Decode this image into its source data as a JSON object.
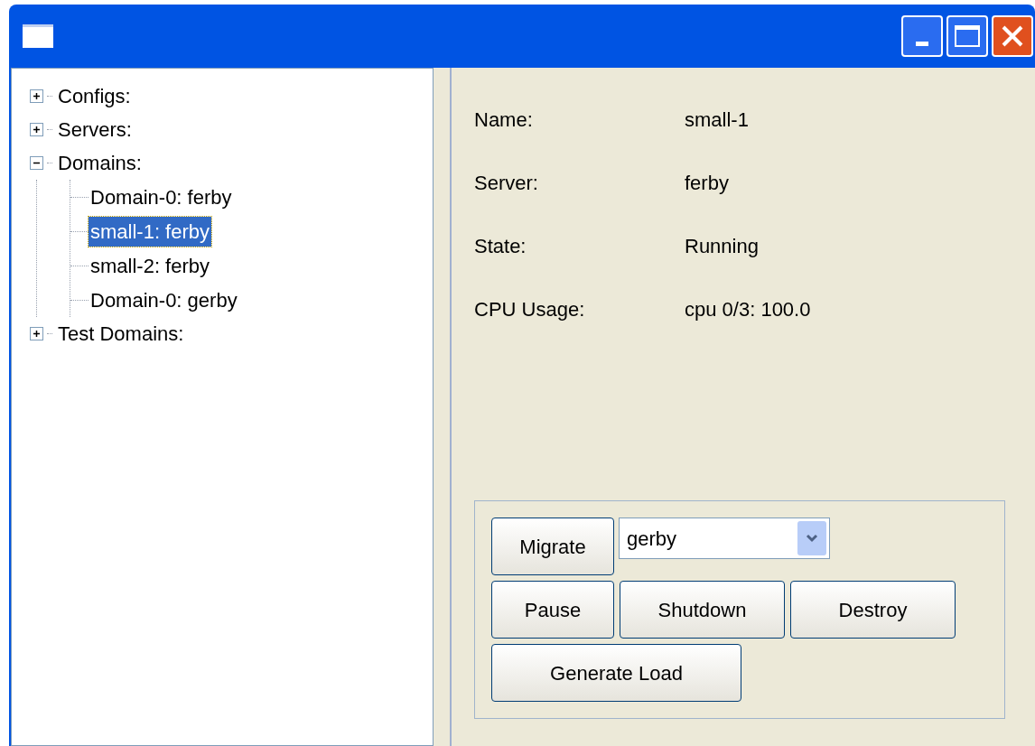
{
  "tree": [
    {
      "label": "Configs:",
      "expanded": false,
      "selected": false
    },
    {
      "label": "Servers:",
      "expanded": false,
      "selected": false
    },
    {
      "label": "Domains:",
      "expanded": true,
      "selected": false,
      "children": [
        {
          "label": "Domain-0: ferby",
          "selected": false
        },
        {
          "label": "small-1: ferby",
          "selected": true
        },
        {
          "label": "small-2: ferby",
          "selected": false
        },
        {
          "label": "Domain-0: gerby",
          "selected": false
        }
      ]
    },
    {
      "label": "Test Domains:",
      "expanded": false,
      "selected": false
    }
  ],
  "details": [
    {
      "label": "Name:",
      "value": "small-1"
    },
    {
      "label": "Server:",
      "value": "ferby"
    },
    {
      "label": "State:",
      "value": "Running"
    },
    {
      "label": "CPU Usage:",
      "value": "cpu 0/3: 100.0"
    }
  ],
  "actions": {
    "migrate": "Migrate",
    "target": "gerby",
    "row2": [
      "Pause",
      "Shutdown",
      "Destroy"
    ],
    "generate": "Generate Load"
  }
}
